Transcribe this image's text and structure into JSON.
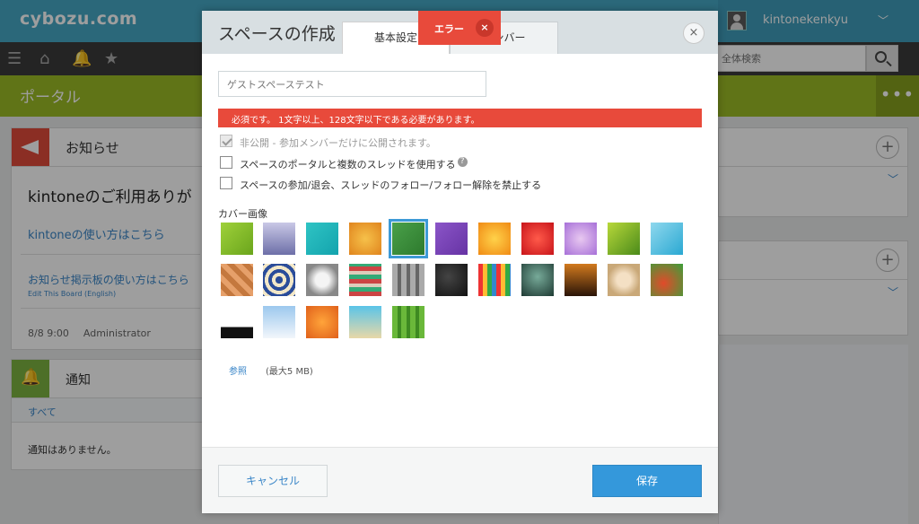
{
  "header": {
    "logo": "cybozu.com",
    "user_name": "kintonekenkyu",
    "user_caret": "﹀"
  },
  "toolbar": {
    "search_placeholder": "全体検索"
  },
  "portal": {
    "title": "ポータル",
    "more": "•••"
  },
  "notice": {
    "title": "お知らせ",
    "headline": "kintoneのご利用ありが",
    "link1": "kintoneの使い方はこちら",
    "link2": "お知らせ掲示板の使い方はこちら",
    "link3": "Edit This Board (English)",
    "date": "8/8 9:00",
    "author": "Administrator"
  },
  "alerts": {
    "title": "通知",
    "all": "すべて",
    "empty": "通知はありません。"
  },
  "right": {
    "plus": "+",
    "chevron": "﹀"
  },
  "modal": {
    "title": "スペースの作成",
    "tab_basic": "基本設定",
    "tab_member": "メンバー",
    "close": "×",
    "error_tab_label": "エラー",
    "error_tab_close": "×",
    "name_value": "ゲストスペーステスト",
    "error_message": "必須です。 1文字以上、128文字以下である必要があります。",
    "checkboxes": [
      {
        "label": "非公開 - 参加メンバーだけに公開されます。",
        "checked": true,
        "disabled": true
      },
      {
        "label": "スペースのポータルと複数のスレッドを使用する",
        "checked": false,
        "help": "?"
      },
      {
        "label": "スペースの参加/退会、スレッドのフォロー/フォロー解除を禁止する",
        "checked": false
      }
    ],
    "cover_label": "カバー画像",
    "browse": "参照",
    "max_size": "(最大5 MB)",
    "cancel": "キャンセル",
    "save": "保存"
  },
  "colors": {
    "header": "#46a8c6",
    "portal_bar": "#9cbb26",
    "error": "#e84a3b",
    "primary": "#3498db",
    "link": "#3a86c8"
  }
}
